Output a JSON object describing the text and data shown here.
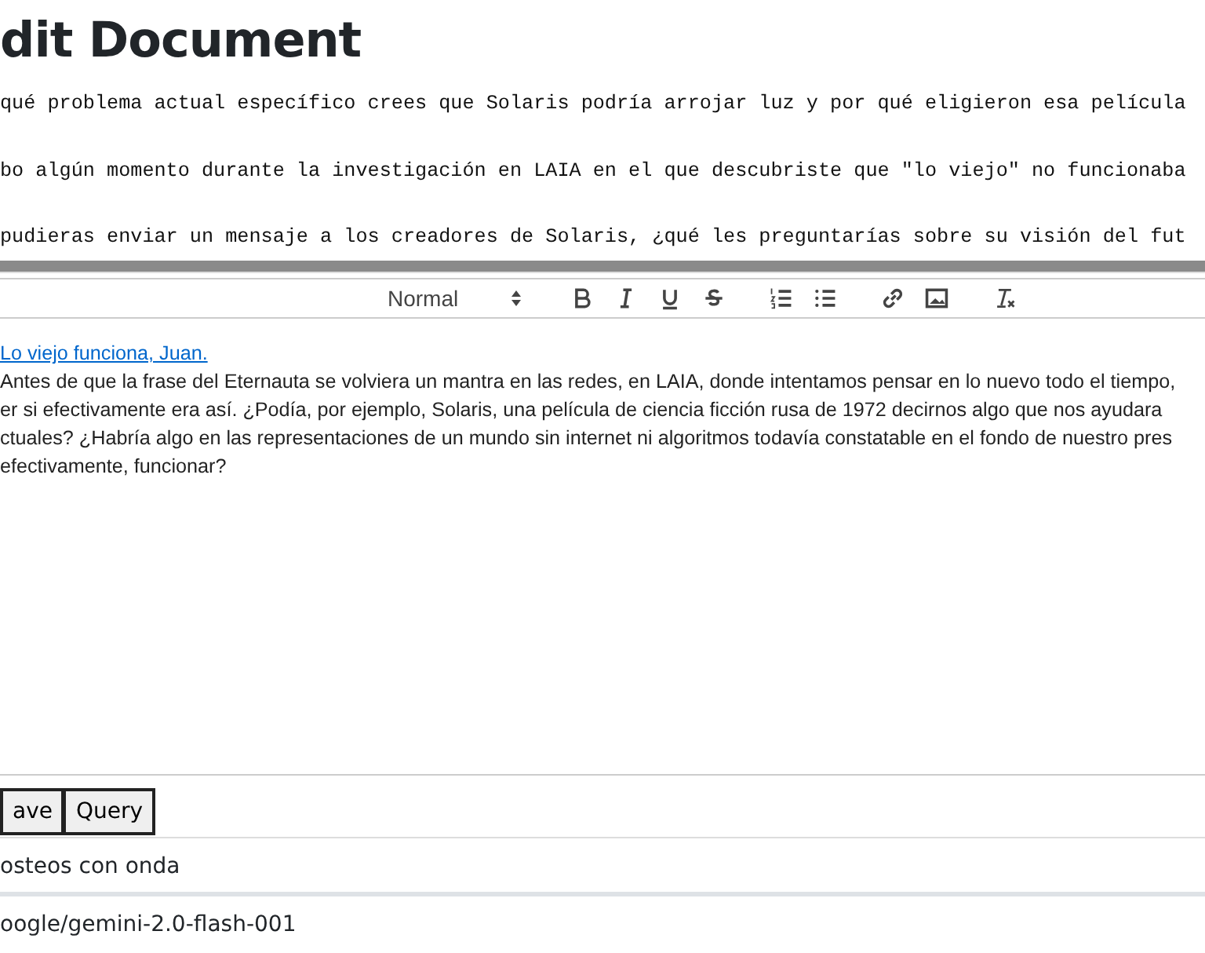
{
  "page_title": "dit Document",
  "questions": [
    "qué problema actual específico crees que Solaris podría arrojar luz y por qué eligieron esa película",
    "bo algún momento durante la investigación en LAIA en el que descubriste que \"lo viejo\" no funcionaba",
    "pudieras enviar un mensaje a los creadores de Solaris, ¿qué les preguntarías sobre su visión del fut"
  ],
  "editor": {
    "toolbar": {
      "format": "Normal",
      "tools": [
        {
          "kind": "bold"
        },
        {
          "kind": "italic"
        },
        {
          "kind": "underline"
        },
        {
          "kind": "strike"
        },
        {
          "kind": "ordered-list"
        },
        {
          "kind": "bullet-list"
        },
        {
          "kind": "link"
        },
        {
          "kind": "image"
        },
        {
          "kind": "clean"
        }
      ]
    },
    "link": "Lo viejo funciona, Juan.",
    "lines": [
      "Antes de que la frase del Eternauta se volviera un mantra en las redes, en LAIA, donde intentamos pensar en lo nuevo todo el tiempo,",
      "er si efectivamente era así. ¿Podía, por ejemplo, Solaris, una película de ciencia ficción rusa de 1972 decirnos algo que nos ayudara",
      "ctuales? ¿Habría algo en las representaciones de un mundo sin internet ni algoritmos todavía constatable en el fondo de nuestro pres",
      "efectivamente, funcionar?"
    ]
  },
  "buttons": [
    "ave",
    "Query"
  ],
  "rows": [
    "osteos con onda",
    "oogle/gemini-2.0-flash-001"
  ]
}
